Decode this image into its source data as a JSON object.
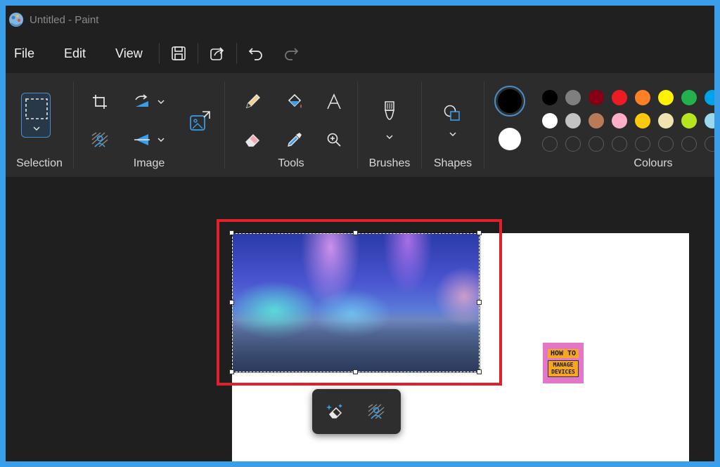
{
  "window": {
    "title": "Untitled - Paint"
  },
  "menu": {
    "file": "File",
    "edit": "Edit",
    "view": "View"
  },
  "ribbon": {
    "groups": {
      "selection": "Selection",
      "image": "Image",
      "tools": "Tools",
      "brushes": "Brushes",
      "shapes": "Shapes",
      "colours": "Colours"
    }
  },
  "palette": {
    "primary": "#000000",
    "secondary": "#ffffff",
    "row1": [
      "#000000",
      "#7f7f7f",
      "#880015",
      "#ed1c24",
      "#ff7f27",
      "#fff200",
      "#22b14c",
      "#00a2e8"
    ],
    "row2": [
      "#ffffff",
      "#c3c3c3",
      "#b97a57",
      "#ffaec9",
      "#ffc90e",
      "#efe4b0",
      "#b5e61d",
      "#99d9ea"
    ],
    "row3_custom_slots": 8
  },
  "canvas": {
    "logo_line1": "HOW TO",
    "logo_line2": "MANAGE DEVICES"
  },
  "colors": {
    "highlight": "#e0202a",
    "accent": "#3a9ee8"
  }
}
